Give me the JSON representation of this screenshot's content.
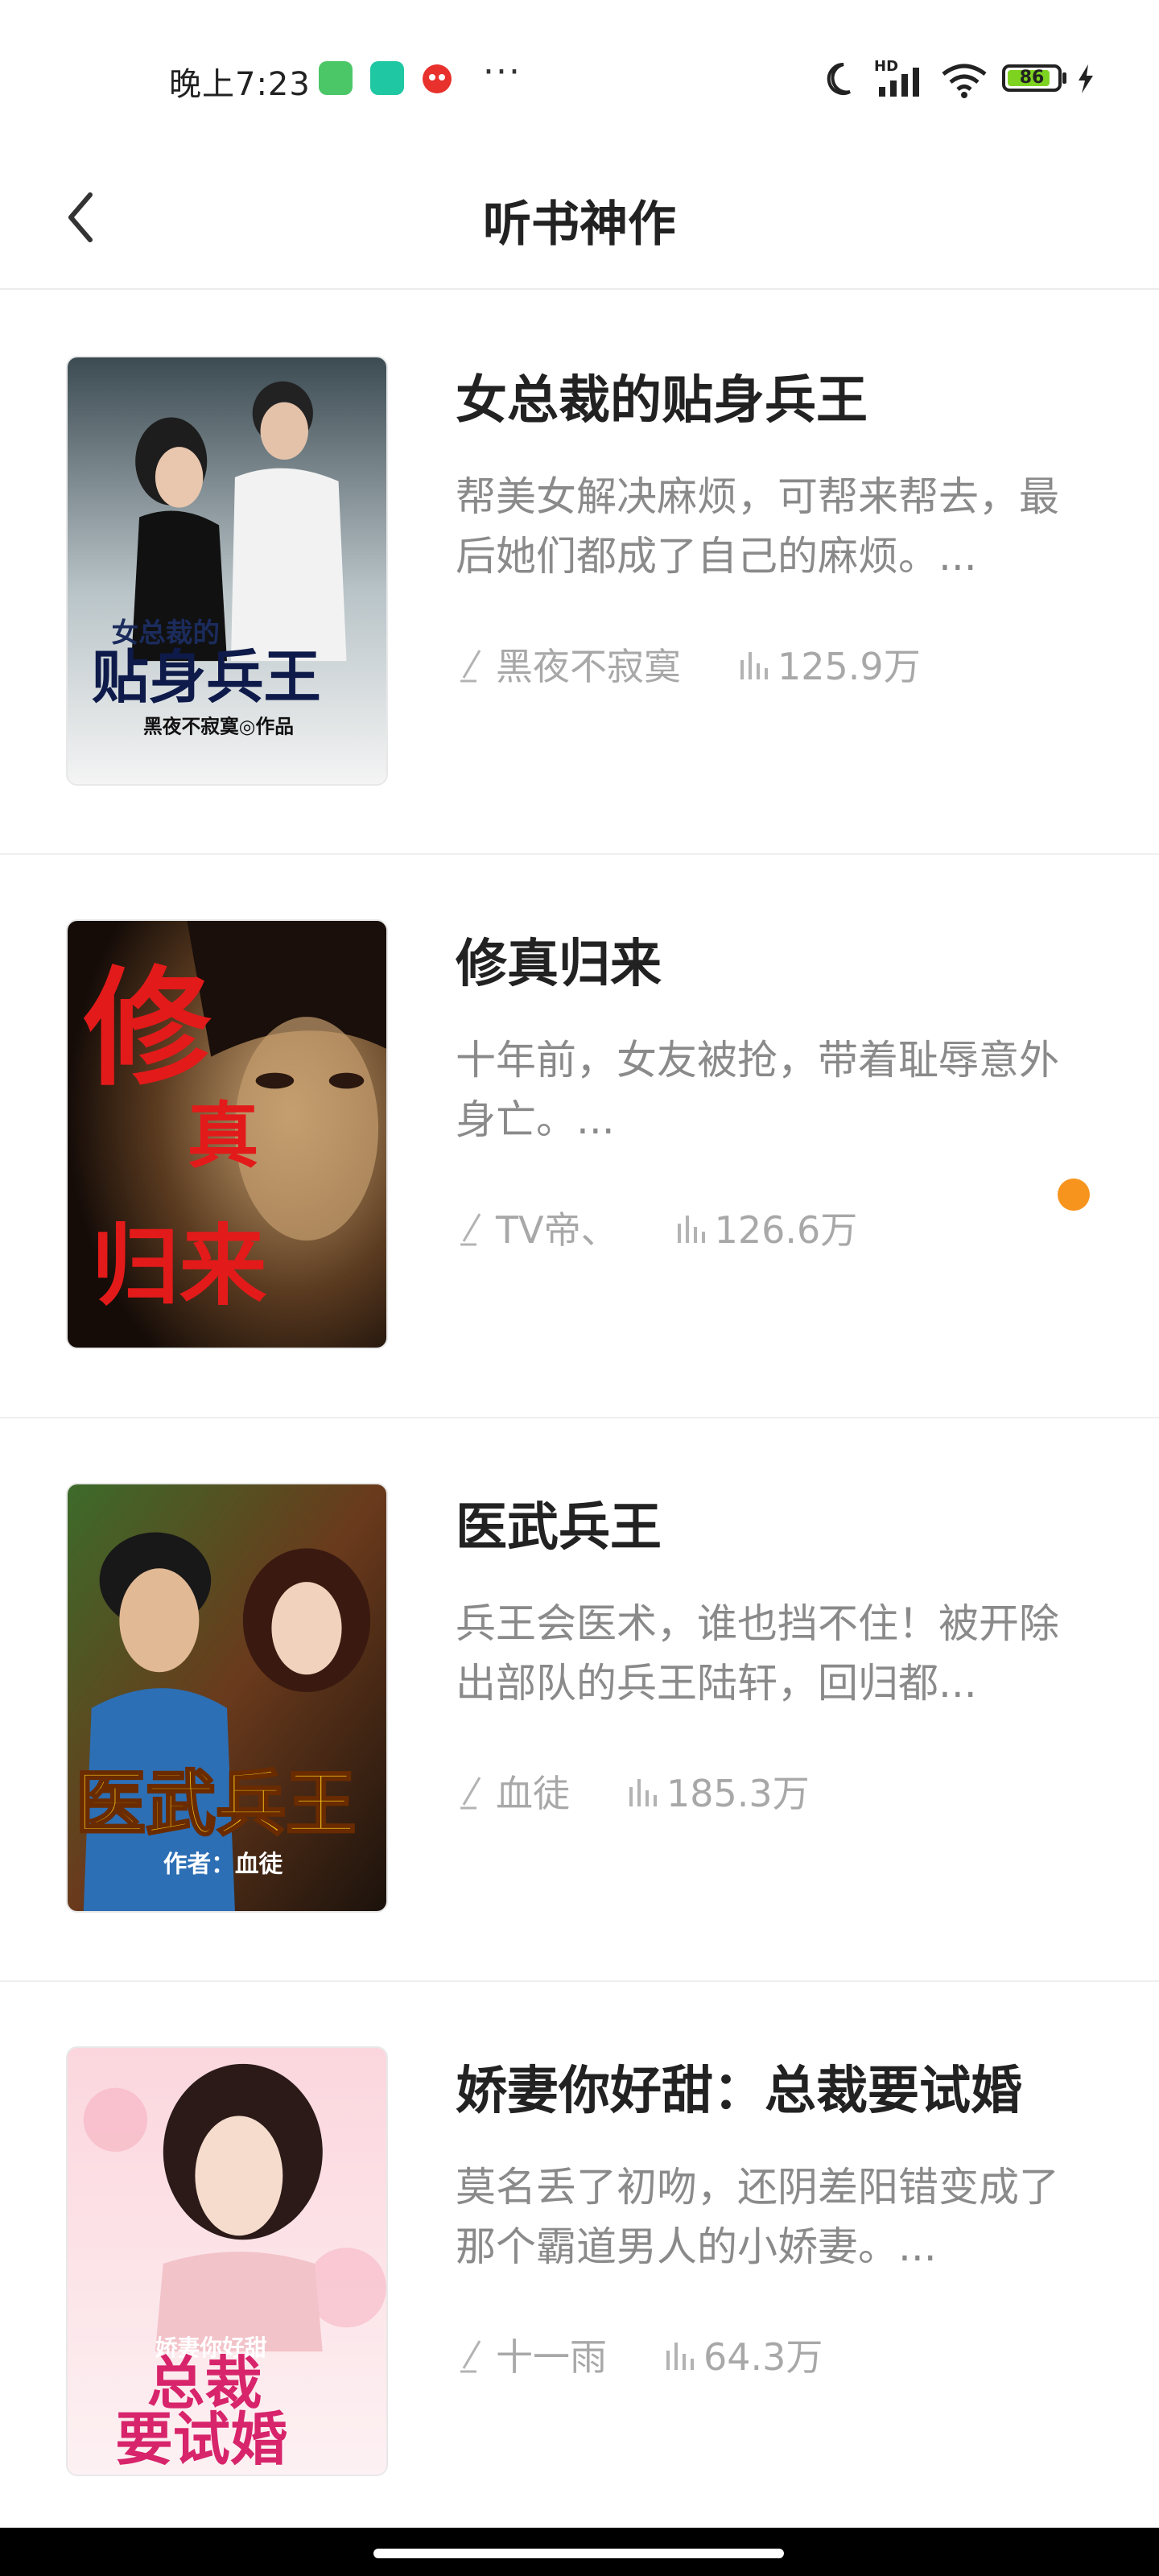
{
  "status_bar": {
    "time": "晚上7:23",
    "more": "···",
    "network": "HD",
    "battery": "86",
    "icons": [
      "app-icon-green",
      "app-icon-teal",
      "app-icon-red",
      "moon-icon",
      "signal-icon",
      "wifi-icon",
      "battery-icon",
      "charging-icon"
    ]
  },
  "header": {
    "title": "听书神作",
    "back_icon": "chevron-left-icon"
  },
  "books": [
    {
      "title": "女总裁的贴身兵王",
      "desc": "帮美女解决麻烦，可帮来帮去，最后她们都成了自己的麻烦。...",
      "author": "黑夜不寂寞",
      "plays": "125.9万",
      "cover_text_top": "女总裁的",
      "cover_text_main": "贴身兵王",
      "cover_text_sub": "黑夜不寂寞◎作品"
    },
    {
      "title": "修真归来",
      "desc": "十年前，女友被抢，带着耻辱意外身亡。...",
      "author": "TV帝、",
      "plays": "126.6万",
      "cover_text_top": "修",
      "cover_text_main": "真",
      "cover_text_sub": "归来"
    },
    {
      "title": "医武兵王",
      "desc": "兵王会医术，谁也挡不住！被开除出部队的兵王陆轩，回归都...",
      "author": "血徒",
      "plays": "185.3万",
      "cover_text_main": "医武兵王",
      "cover_text_sub": "作者：血徒"
    },
    {
      "title": "娇妻你好甜：总裁要试婚",
      "desc": "莫名丢了初吻，还阴差阳错变成了那个霸道男人的小娇妻。...",
      "author": "十一雨",
      "plays": "64.3万",
      "cover_text_top": "娇妻你好甜",
      "cover_text_main": "总裁",
      "cover_text_sub": "要试婚"
    }
  ],
  "colors": {
    "accent_dot": "#f7941d",
    "title": "#222222",
    "desc": "#8a8a8a",
    "meta": "#a8a8a8"
  }
}
